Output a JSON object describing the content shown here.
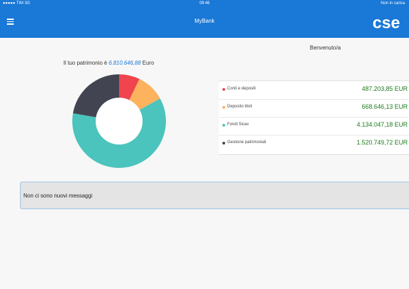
{
  "status_bar": {
    "carrier": "●●●●● TIM  3G",
    "time": "09:46",
    "charging": "Non in carica"
  },
  "navbar": {
    "title": "MyBank",
    "logo_text": "cse",
    "menu_icon": "hamburger-menu-icon"
  },
  "welcome": "Benvenuto/a",
  "patrimonio": {
    "prefix": "Il tuo patrimonio è ",
    "value": "6.810.646,88",
    "suffix": " Euro"
  },
  "accounts": [
    {
      "label": "Conti e depositi",
      "value": "487.203,85 EUR",
      "color": "#f0454e"
    },
    {
      "label": "Deposito titoli",
      "value": "668.646,13 EUR",
      "color": "#fdb25e"
    },
    {
      "label": "Fondi Sicav",
      "value": "4.134.047,18 EUR",
      "color": "#4bc4bd"
    },
    {
      "label": "Gestione patrimoniali",
      "value": "1.520.749,72 EUR",
      "color": "#424452"
    }
  ],
  "chart_data": {
    "type": "pie",
    "categories": [
      "Conti e depositi",
      "Deposito titoli",
      "Fondi Sicav",
      "Gestione patrimoniali"
    ],
    "values": [
      487203.85,
      668646.13,
      4134047.18,
      1520749.72
    ],
    "colors": [
      "#f0454e",
      "#fdb25e",
      "#4bc4bd",
      "#424452"
    ],
    "donut": true
  },
  "messages": {
    "text": "Non ci sono nuovi messaggi"
  },
  "colors": {
    "primary": "#1a78d6",
    "value_green": "#1c7a1c",
    "background": "#f7f7f7"
  }
}
